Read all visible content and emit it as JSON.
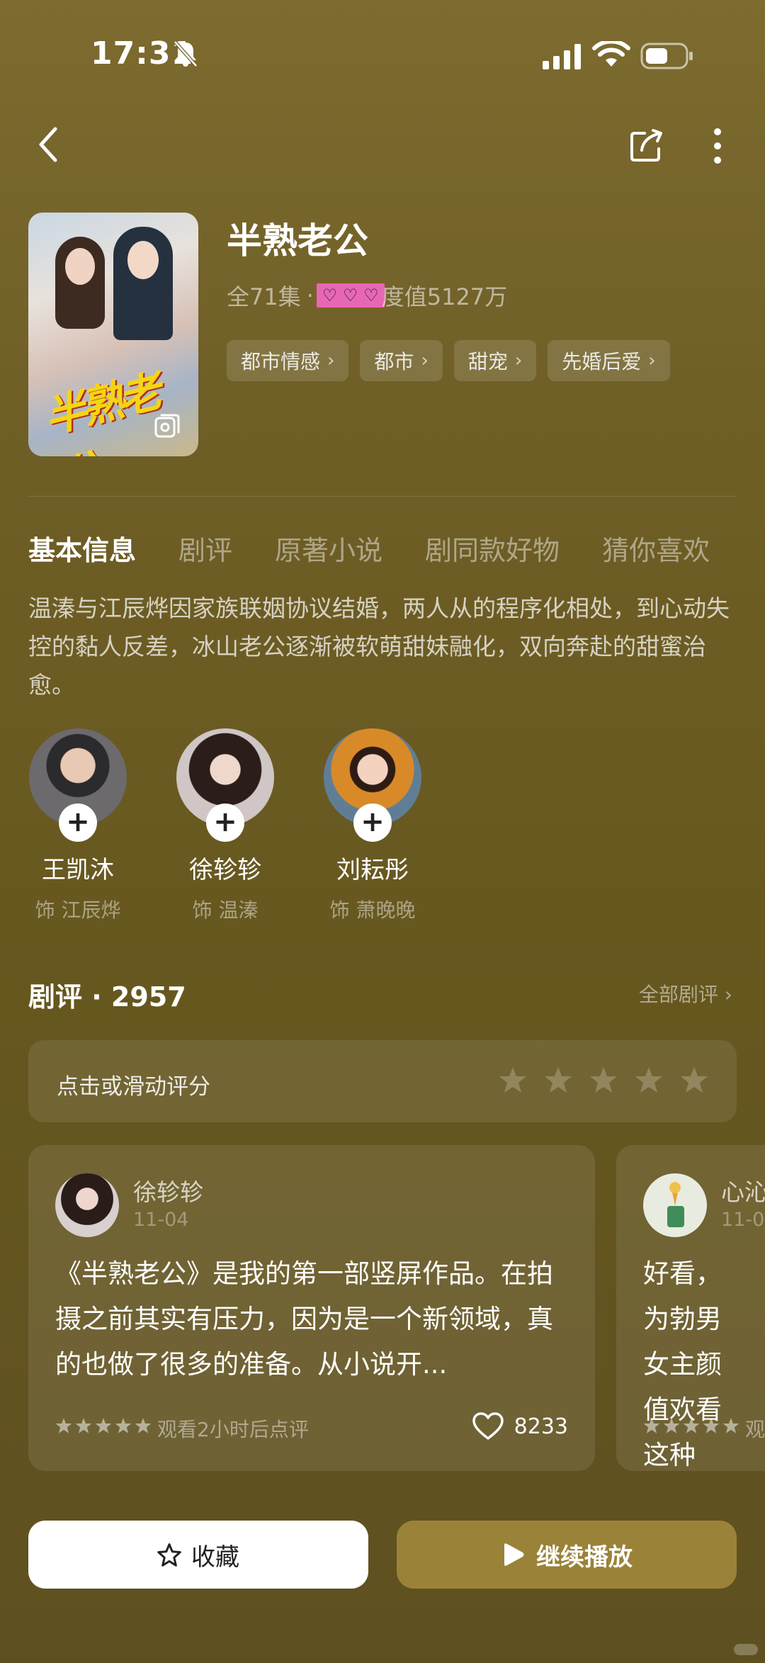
{
  "status_bar": {
    "time": "17:31"
  },
  "show": {
    "title": "半熟老公",
    "episodes": "全71集",
    "dot": "·",
    "meta_prefix": "全",
    "meta_suffix": "度值5127万",
    "tags": [
      "都市情感",
      "都市",
      "甜宠",
      "先婚后爱"
    ]
  },
  "tabs": [
    "基本信息",
    "剧评",
    "原著小说",
    "剧同款好物",
    "猜你喜欢"
  ],
  "synopsis": "温溱与江辰烨因家族联姻协议结婚，两人从的程序化相处，到心动失控的黏人反差，冰山老公逐渐被软萌甜妹融化，双向奔赴的甜蜜治愈。",
  "cast": [
    {
      "name": "王凯沐",
      "role": "饰 江辰烨"
    },
    {
      "name": "徐轸轸",
      "role": "饰 温溱"
    },
    {
      "name": "刘耘彤",
      "role": "饰 萧晚晚"
    }
  ],
  "reviews": {
    "heading": "剧评 · 2957",
    "all_link": "全部剧评 ›",
    "rate_prompt": "点击或滑动评分",
    "cards": [
      {
        "user": "徐轸轸",
        "date": "11-04",
        "text": "《半熟老公》是我的第一部竖屏作品。在拍摄之前其实有压力，因为是一个新领域，真的也做了很多的准备。从小说开...",
        "footnote": "观看2小时后点评",
        "likes": "8233"
      },
      {
        "user": "心沁",
        "date": "11-0",
        "text": "好看，为勃男女主颜值欢看这种",
        "footnote": "观"
      }
    ]
  },
  "actions": {
    "favorite": "收藏",
    "play": "继续播放"
  },
  "colors": {
    "background": "#6f5f27",
    "play_button": "#9a8238",
    "hearts_badge": "#e867b5"
  }
}
